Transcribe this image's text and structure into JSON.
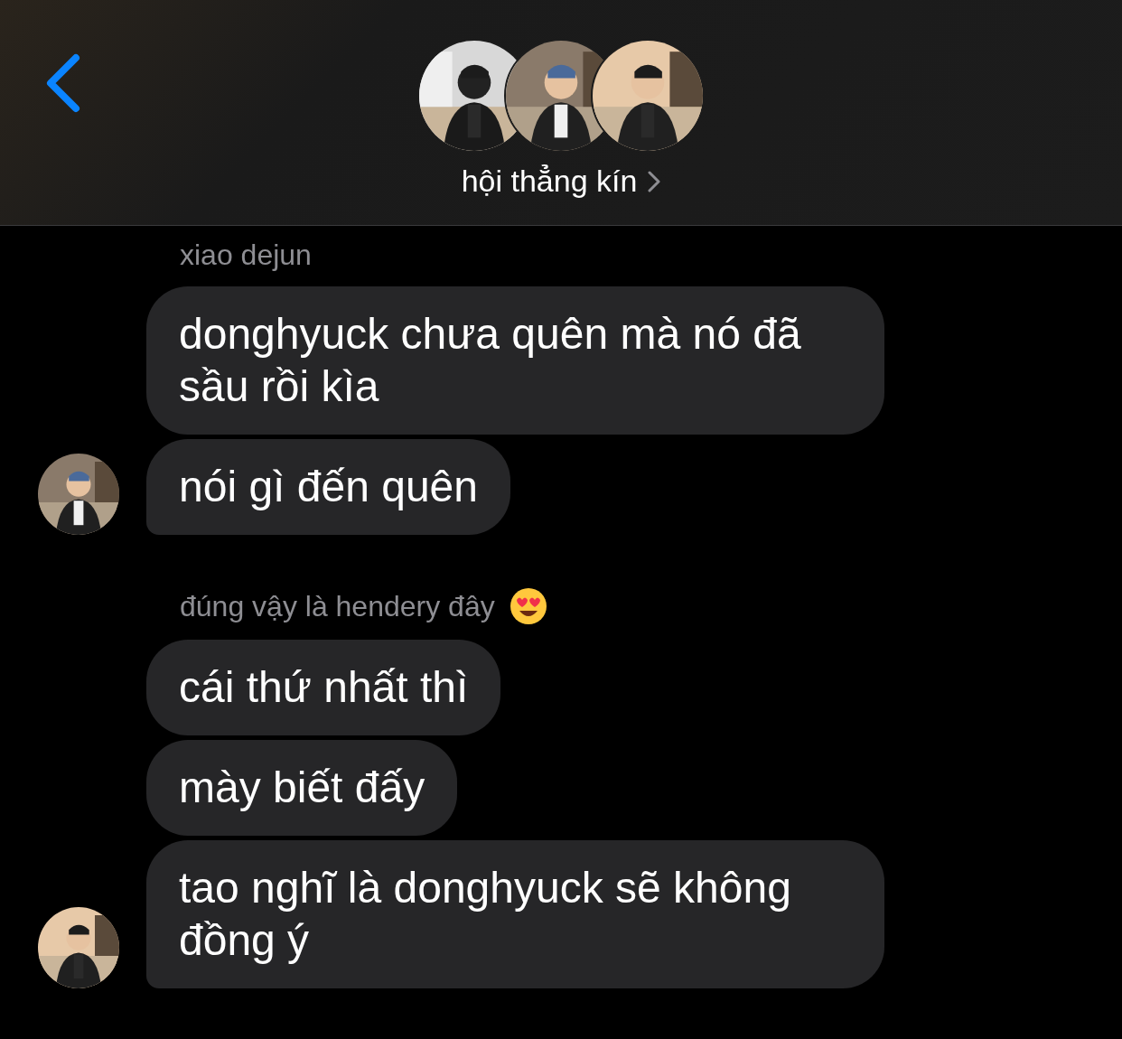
{
  "header": {
    "title": "hội thẳng kín"
  },
  "groups": [
    {
      "sender": "xiao dejun",
      "has_emoji": false,
      "messages": [
        "donghyuck chưa quên mà nó đã sầu rồi kìa",
        "nói gì đến quên"
      ]
    },
    {
      "sender": "đúng vậy là hendery đây",
      "has_emoji": true,
      "messages": [
        "cái thứ nhất thì",
        "mày biết đấy",
        "tao nghĩ là donghyuck sẽ không đồng ý"
      ]
    }
  ]
}
